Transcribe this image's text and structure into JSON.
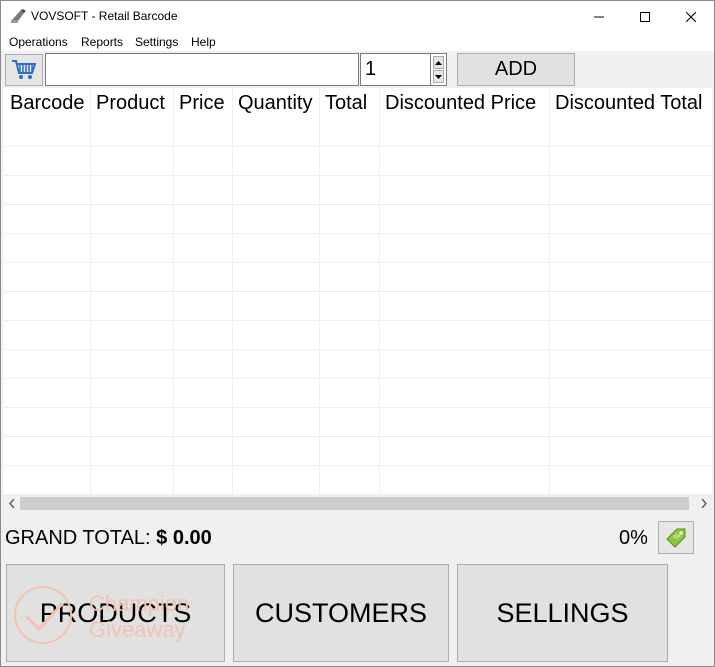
{
  "window": {
    "title": "VOVSOFT - Retail Barcode"
  },
  "menu": [
    "Operations",
    "Reports",
    "Settings",
    "Help"
  ],
  "toolbar": {
    "barcode_value": "",
    "quantity_value": "1",
    "add_label": "ADD"
  },
  "grid": {
    "columns": [
      "Barcode",
      "Product",
      "Price",
      "Quantity",
      "Total",
      "Discounted Price",
      "Discounted Total"
    ]
  },
  "summary": {
    "grand_total_label": "GRAND TOTAL:",
    "grand_total_value": "$ 0.00",
    "discount_percent": "0%"
  },
  "buttons": {
    "products": "PRODUCTS",
    "customers": "CUSTOMERS",
    "sellings": "SELLINGS"
  },
  "watermark": {
    "line1": "Champion",
    "line2": "Giveaway"
  },
  "colors": {
    "window_bg": "#f0f0f0",
    "button_bg": "#e1e1e1",
    "button_border": "#adadad",
    "watermark": "#f3c2b0"
  }
}
